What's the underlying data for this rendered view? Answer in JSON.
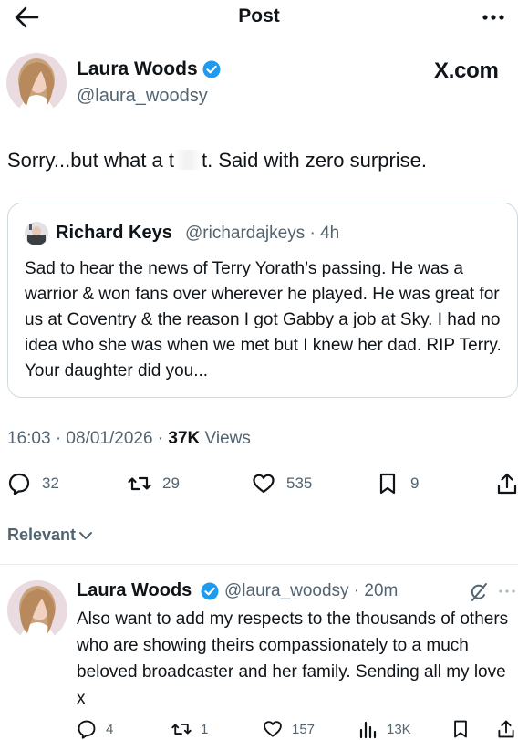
{
  "header": {
    "title": "Post",
    "back_icon": "arrow-left-icon",
    "more_icon": "more-horizontal-icon"
  },
  "main_post": {
    "author_name": "Laura Woods",
    "author_handle": "@laura_woodsy",
    "verified": true,
    "brand": "X.com",
    "text_before": "Sorry...but what a t",
    "text_after": "t. Said with zero surprise."
  },
  "quote": {
    "author_name": "Richard Keys",
    "handle_time": "@richardajkeys · 4h",
    "text": "Sad to hear the news of Terry Yorath’s passing. He was a warrior & won fans over wherever he played. He was great for us at Coventry & the reason I got Gabby a job at Sky. I had no idea who she was when we met but I knew her dad. RIP Terry. Your daughter did you..."
  },
  "meta": {
    "datetime": "16:03 · 08/01/2026 · ",
    "views_count": "37K",
    "views_label": " Views"
  },
  "actions": {
    "replies": "32",
    "reposts": "29",
    "likes": "535",
    "bookmarks": "9"
  },
  "sort": {
    "label": "Relevant"
  },
  "reply": {
    "author_name": "Laura Woods",
    "handle_time": "@laura_woodsy · 20m",
    "verified": true,
    "text": "Also want to add my respects to the thousands of others who are showing theirs compassionately to a much beloved broadcaster and her family. Sending all my love x",
    "replies": "4",
    "reposts": "1",
    "likes": "157",
    "views": "13K"
  },
  "colors": {
    "text": "#0f1419",
    "secondary": "#536471",
    "verified": "#1d9bf0",
    "border": "#cfd9de"
  }
}
